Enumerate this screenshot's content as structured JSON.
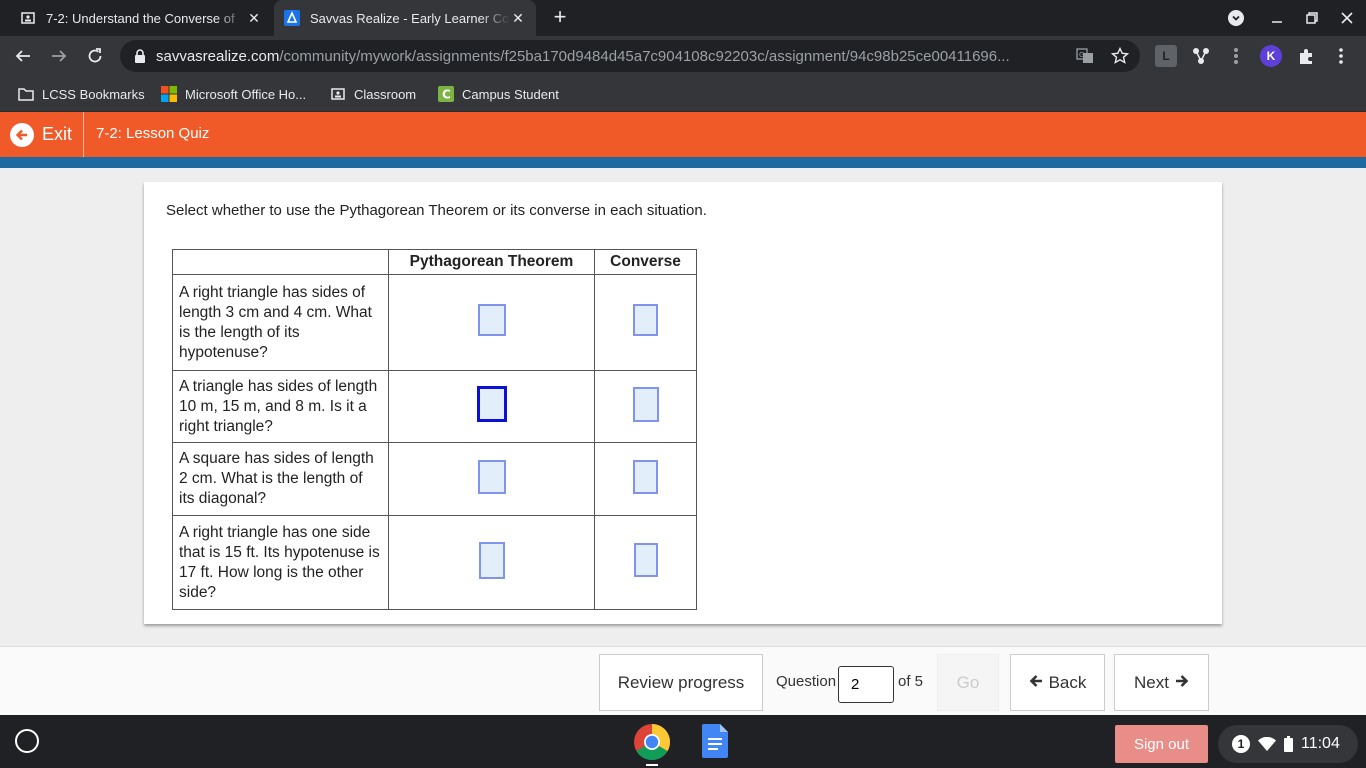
{
  "browser": {
    "tabs": [
      {
        "title": "7-2: Understand the Converse of"
      },
      {
        "title": "Savvas Realize - Early Learner Co"
      }
    ],
    "url_host": "savvasrealize.com",
    "url_path": "/community/mywork/assignments/f25ba170d9484d45a7c904108c92203c/assignment/94c98b25ce00411696...",
    "bookmarks": [
      {
        "label": "LCSS Bookmarks",
        "icon": "folder-icon"
      },
      {
        "label": "Microsoft Office Ho...",
        "icon": "microsoft-logo-icon"
      },
      {
        "label": "Classroom",
        "icon": "classroom-icon"
      },
      {
        "label": "Campus Student",
        "icon": "campus-icon"
      }
    ],
    "extensions": [
      {
        "label": "L"
      },
      {
        "label": "K"
      }
    ]
  },
  "app": {
    "exit_label": "Exit",
    "title": "7-2: Lesson Quiz",
    "colors": {
      "header": "#f05a28",
      "bar": "#1c6aa0"
    }
  },
  "question": {
    "prompt": "Select whether to use the Pythagorean Theorem or its converse in each situation.",
    "headers": [
      "",
      "Pythagorean Theorem",
      "Converse"
    ],
    "rows": [
      {
        "situation": "A right triangle has sides of length 3 cm and 4 cm. What is the length of its hypotenuse?"
      },
      {
        "situation": "A triangle has sides of length 10 m, 15 m, and 8 m. Is it a right triangle?"
      },
      {
        "situation": "A square has sides of length 2 cm. What is the length of its diagonal?"
      },
      {
        "situation": "A right triangle has one side that is 15 ft. Its hypotenuse is 17 ft. How long is the other side?"
      }
    ]
  },
  "footer": {
    "review_label": "Review progress",
    "question_label": "Question",
    "question_value": "2",
    "of_label": "of 5",
    "go_label": "Go",
    "back_label": "Back",
    "next_label": "Next"
  },
  "shelf": {
    "signout_label": "Sign out",
    "notification_count": "1",
    "time": "11:04"
  }
}
